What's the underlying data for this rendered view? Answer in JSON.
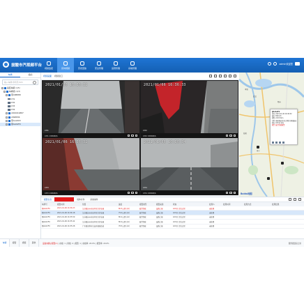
{
  "app": {
    "title": "拔酸市汽视频平台",
    "nav": [
      {
        "label": "视频监控",
        "active": false
      },
      {
        "label": "实时视频",
        "active": true
      },
      {
        "label": "历史回放",
        "active": false
      },
      {
        "label": "安全管理",
        "active": false
      },
      {
        "label": "运营管理",
        "active": false
      },
      {
        "label": "系统管理",
        "active": false
      }
    ],
    "user": "admin欢迎您"
  },
  "left_panel": {
    "tabs": [
      "车辆",
      "组织"
    ],
    "search_placeholder": "输入车牌/手机号/SIM",
    "tree": [
      {
        "label": "速度车辆 (1/5)",
        "level": 0
      },
      {
        "label": "车辆组 (1/3)",
        "level": 1
      },
      {
        "label": "鄂A88888",
        "level": 2
      },
      {
        "label": "CH1",
        "level": 3
      },
      {
        "label": "CH2",
        "level": 3
      },
      {
        "label": "CH3",
        "level": 3
      },
      {
        "label": "CH4",
        "level": 3
      },
      {
        "label": "2200019887",
        "level": 2
      },
      {
        "label": "2098836",
        "level": 2
      },
      {
        "label": "鄂AA2203",
        "level": 2
      },
      {
        "label": "鄂A2A2F9",
        "level": 2,
        "selected": true
      }
    ]
  },
  "toolbar": {
    "items": [
      "视频画面",
      "视频窗口"
    ]
  },
  "videos": [
    {
      "timestamp": "2021/01/06 16:36:32",
      "label": "CH1",
      "info": "CH1 158KB/S"
    },
    {
      "timestamp": "2021/01/06 16:36:33",
      "label": "CH2",
      "info": "CH2 158KB/S"
    },
    {
      "timestamp": "2021/01/06 16:36:32",
      "label": "CH3",
      "info": "CH3 158KB/S"
    },
    {
      "timestamp": "2021/01/06 16:36:34",
      "label": "CH4",
      "info": "CH4 158KB/S"
    }
  ],
  "map": {
    "labels": [
      "武汉",
      "鄂州",
      "黄石",
      "咸宁",
      "孝感",
      "仙桃"
    ],
    "popup": {
      "title": "鄂A2A2F9",
      "time": "时间: 2021-01-06 16:36:32",
      "speed": "速度: 80km/h",
      "mileage": "里程: 2233.5km",
      "location": "位置: 湖北省武汉市江夏区京港澳高速",
      "alarm": "报警: 疲劳驾驶报警",
      "status": "状态: ACC开 定位"
    },
    "logo": "Baidu地图"
  },
  "bottom": {
    "tabs": [
      {
        "label": "报警信息",
        "type": "normal"
      },
      {
        "label": "",
        "type": "alarm"
      },
      {
        "label": "媒体文件",
        "type": "normal"
      },
      {
        "label": "系统事件",
        "type": "normal"
      }
    ],
    "columns": [
      "车牌号",
      "报警时间",
      "位置",
      "速度",
      "报警类型",
      "报警来源",
      "状态",
      "处理人",
      "处理时间",
      "处理方式",
      "处理结果"
    ],
    "rows": [
      {
        "cells": [
          "鄂A2A2F9",
          "2021-01-06 16:36:23",
          "江苏省苏州市吴中区京沪高速",
          "80.5公里/小时",
          "疲劳驾驶",
          "设备上报",
          "ACC开 定位正常",
          "未处理",
          "",
          "",
          ""
        ],
        "style": "red"
      },
      {
        "cells": [
          "鄂A2A2F9",
          "2021-01-06 16:36:18",
          "江苏省苏州市吴中区京沪高速",
          "79.0公里/小时",
          "疲劳驾驶",
          "设备上报",
          "ACC开 定位正常",
          "未处理",
          "",
          "",
          ""
        ],
        "style": "sel"
      },
      {
        "cells": [
          "鄂A2A2F9",
          "2021-01-06 16:35:59",
          "江苏省苏州市吴中区京沪高速",
          "80.2公里/小时",
          "疲劳驾驶",
          "设备上报",
          "ACC开 定位正常",
          "未处理",
          "",
          "",
          ""
        ],
        "style": "normal"
      },
      {
        "cells": [
          "鄂A2A2F9",
          "2021-01-06 16:35:42",
          "江苏省苏州市吴中区京沪高速",
          "80.0公里/小时",
          "疲劳驾驶",
          "设备上报",
          "ACC开 定位正常",
          "未处理",
          "",
          "",
          ""
        ],
        "style": "normal"
      },
      {
        "cells": [
          "鄂A2A2F9",
          "2021-01-06 16:35:28",
          "广东省深圳市宝安区福海街道",
          "78.5公里/小时",
          "疲劳驾驶",
          "设备上报",
          "ACC开 定位正常",
          "未处理",
          "",
          "",
          ""
        ],
        "style": "normal"
      }
    ]
  },
  "status_bar": {
    "tabs": [
      "车辆",
      "报警",
      "视频",
      "其他"
    ],
    "warning": "设备未确认报警(1)",
    "text": "| 在线: 1 | 离线: 4 | 报警: 1 | 在线率: 20.0% | 报警率: 20.0%",
    "right": "服务器连接正常"
  }
}
